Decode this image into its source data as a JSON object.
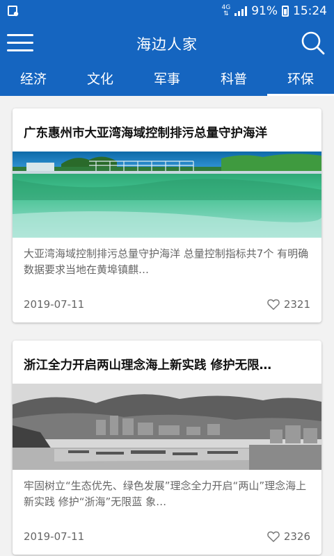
{
  "status_bar": {
    "network": "4G",
    "battery_percent": "91%",
    "time": "15:24"
  },
  "app_bar": {
    "title": "海边人家",
    "menu_icon": "menu-icon",
    "search_icon": "search-icon"
  },
  "tabs": [
    {
      "label": "经济",
      "active": false
    },
    {
      "label": "文化",
      "active": false
    },
    {
      "label": "军事",
      "active": false
    },
    {
      "label": "科普",
      "active": false
    },
    {
      "label": "环保",
      "active": true
    }
  ],
  "articles": [
    {
      "title": "广东惠州市大亚湾海域控制排污总量守护海洋",
      "summary": "  大亚湾海域控制排污总量守护海洋  总量控制指标共7个 有明确数据要求当地在黄埠镇麒…",
      "date": "2019-07-11",
      "likes": "2321"
    },
    {
      "title": "浙江全力开启两山理念海上新实践 修护无限…",
      "summary": "  牢固树立“生态优先、绿色发展”理念全力开启“两山”理念海上新实践 修护“浙海”无限蓝  象…",
      "date": "2019-07-11",
      "likes": "2326"
    }
  ],
  "colors": {
    "brand": "#1565c0",
    "background": "#f2f2f2"
  }
}
